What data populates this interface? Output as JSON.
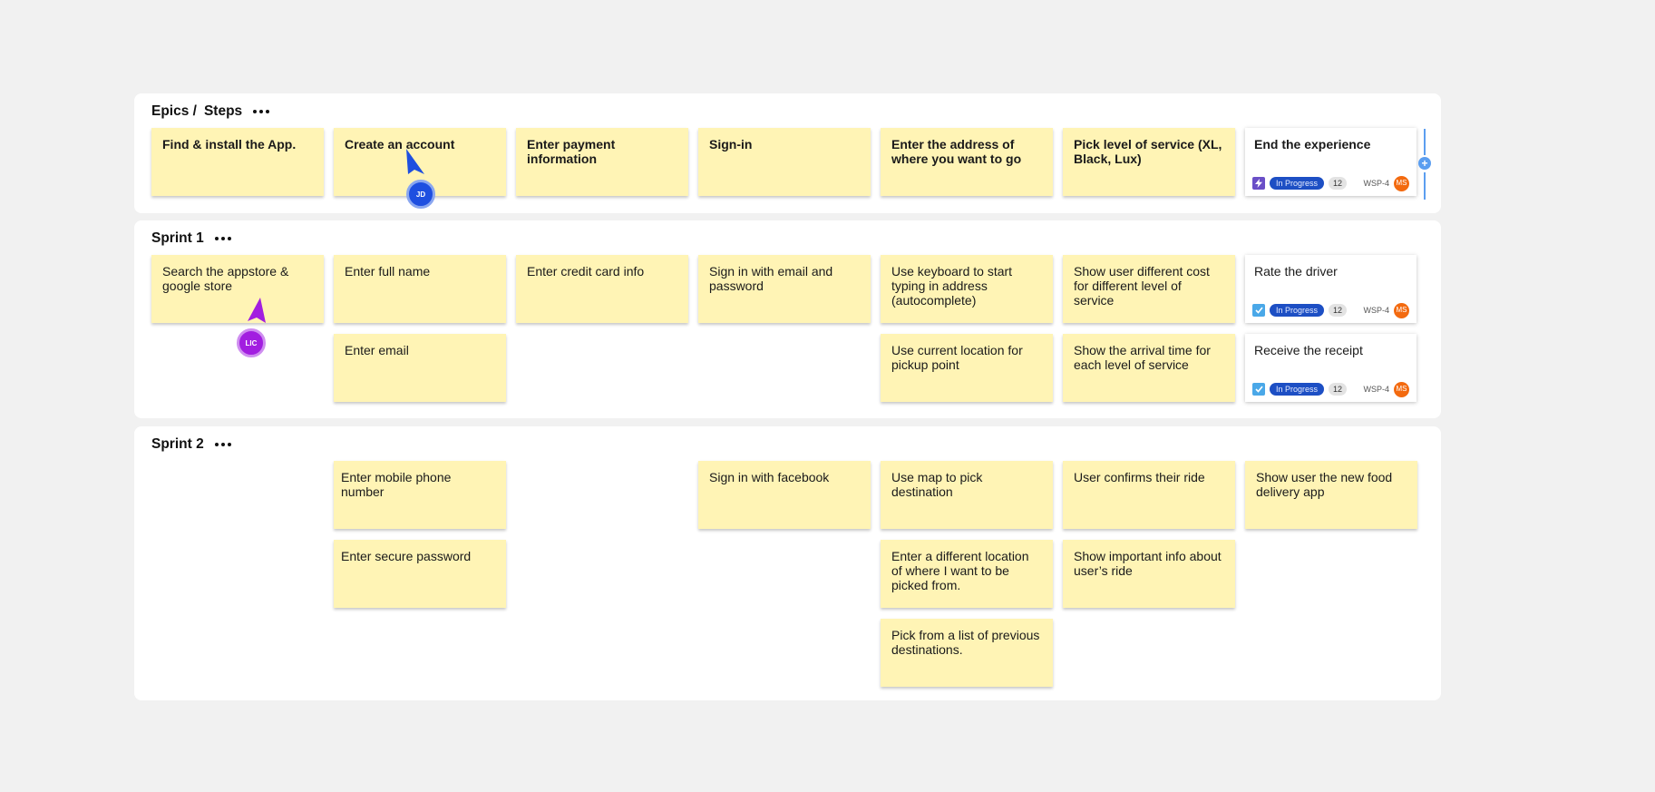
{
  "board": {
    "header_row": {
      "title_part1": "Epics /",
      "title_part2": "Steps",
      "epics": [
        "Find & install the App.",
        "Create an account",
        "Enter payment information",
        "Sign-in",
        "Enter the address of where you want to go",
        "Pick level of service (XL, Black, Lux)"
      ],
      "epic_card": {
        "title": "End the experience",
        "type_icon": "lightning-icon",
        "status": "In Progress",
        "count": "12",
        "key": "WSP-4",
        "assignee": "MS"
      }
    },
    "sprint1": {
      "title": "Sprint 1",
      "stickies": [
        "Search the appstore & google store",
        "Enter full name",
        "Enter email",
        "Enter credit card info",
        "Sign in with email and password",
        "Use keyboard to start typing in address (autocomplete)",
        "Use current location for pickup point",
        "Show user different cost for different level of service",
        "Show the arrival time for each level of service"
      ],
      "cards": [
        {
          "title": "Rate the driver",
          "type_icon": "checkbox-icon",
          "status": "In Progress",
          "count": "12",
          "key": "WSP-4",
          "assignee": "MS"
        },
        {
          "title": "Receive the receipt",
          "type_icon": "checkbox-icon",
          "status": "In Progress",
          "count": "12",
          "key": "WSP-4",
          "assignee": "MS"
        }
      ]
    },
    "sprint2": {
      "title": "Sprint 2",
      "stickies": [
        "Enter mobile phone number",
        "Enter secure password",
        "Sign in with facebook",
        "Use map to pick destination",
        "Enter a different location of where I want to be picked from.",
        "Pick from a list of previous destinations.",
        "User confirms their ride",
        "Show important info about user’s ride",
        "Show user the new food delivery app"
      ]
    }
  },
  "collaborators": [
    {
      "initials": "JD",
      "color": "#1e4fe0"
    },
    {
      "initials": "LIC",
      "color": "#a21ee0"
    }
  ],
  "colors": {
    "sticky": "#fff4b5",
    "status_pill": "#1d4fc4",
    "assignee": "#f36a0f",
    "add_column": "#5b9ef0"
  }
}
